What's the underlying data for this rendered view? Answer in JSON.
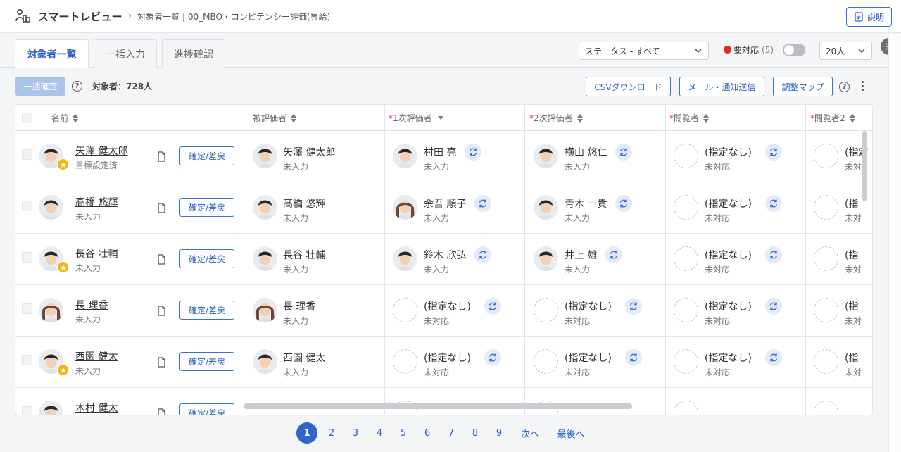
{
  "app": {
    "title": "スマートレビュー",
    "breadcrumb": "対象者一覧 | 00_MBO・コンピテンシー評価(昇給)",
    "help_label": "説明"
  },
  "tabs": [
    {
      "label": "対象者一覧",
      "active": true
    },
    {
      "label": "一括入力",
      "active": false
    },
    {
      "label": "進捗確認",
      "active": false
    }
  ],
  "filters": {
    "status": "ステータス - すべて",
    "urgent_label": "要対応",
    "urgent_count": "(5)",
    "urgent_toggle_on": false,
    "per_page": "20人"
  },
  "toolbar": {
    "bulk_confirm": "一括確定",
    "target_count": "対象者：728人",
    "csv": "CSVダウンロード",
    "mail": "メール・通知送信",
    "map": "調整マップ"
  },
  "columns": {
    "name": "名前",
    "evaluatee": "被評価者",
    "eval1": "1次評価者",
    "eval2": "2次評価者",
    "viewer": "閲覧者",
    "viewer2": "閲覧者2",
    "required_mark": "*"
  },
  "rows": [
    {
      "name": "矢澤 健太郎",
      "status": "目標設定済",
      "star": true,
      "confirm": "確定/差戻",
      "evaluatee": {
        "name": "矢澤 健太郎",
        "status": "未入力"
      },
      "eval1": {
        "name": "村田 亮",
        "status": "未入力",
        "avatar": true
      },
      "eval2": {
        "name": "横山 悠仁",
        "status": "未入力",
        "avatar": true
      },
      "viewer": {
        "name": "(指定なし)",
        "status": "未対応"
      },
      "viewer2": {
        "name": "(指定",
        "status": "未対"
      }
    },
    {
      "name": "髙橋 悠輝",
      "status": "未入力",
      "star": false,
      "confirm": "確定/差戻",
      "evaluatee": {
        "name": "髙橋 悠輝",
        "status": "未入力"
      },
      "eval1": {
        "name": "余吾 順子",
        "status": "未入力",
        "avatar": true
      },
      "eval2": {
        "name": "青木 一貴",
        "status": "未入力",
        "avatar": true
      },
      "viewer": {
        "name": "(指定なし)",
        "status": "未対応"
      },
      "viewer2": {
        "name": "(指",
        "status": "未対"
      }
    },
    {
      "name": "長谷 壮輔",
      "status": "未入力",
      "star": true,
      "confirm": "確定/差戻",
      "evaluatee": {
        "name": "長谷 壮輔",
        "status": "未入力"
      },
      "eval1": {
        "name": "鈴木 欣弘",
        "status": "未入力",
        "avatar": true
      },
      "eval2": {
        "name": "井上 雄",
        "status": "未入力",
        "avatar": true
      },
      "viewer": {
        "name": "(指定なし)",
        "status": "未対応"
      },
      "viewer2": {
        "name": "(指",
        "status": "未対"
      }
    },
    {
      "name": "長 理香",
      "status": "未入力",
      "star": false,
      "confirm": "確定/差戻",
      "evaluatee": {
        "name": "長 理香",
        "status": "未入力"
      },
      "eval1": {
        "name": "(指定なし)",
        "status": "未対応",
        "avatar": false
      },
      "eval2": {
        "name": "(指定なし)",
        "status": "未対応",
        "avatar": false
      },
      "viewer": {
        "name": "(指定なし)",
        "status": "未対応"
      },
      "viewer2": {
        "name": "(指",
        "status": "未対"
      }
    },
    {
      "name": "西園 健太",
      "status": "未入力",
      "star": true,
      "confirm": "確定/差戻",
      "evaluatee": {
        "name": "西園 健太",
        "status": "未入力"
      },
      "eval1": {
        "name": "(指定なし)",
        "status": "未対応",
        "avatar": false
      },
      "eval2": {
        "name": "(指定なし)",
        "status": "未対応",
        "avatar": false
      },
      "viewer": {
        "name": "(指定なし)",
        "status": "未対応"
      },
      "viewer2": {
        "name": "(指",
        "status": "未対"
      }
    },
    {
      "name": "木村 健太",
      "status": "",
      "star": false,
      "confirm": "確定/差戻",
      "evaluatee": {
        "name": "",
        "status": ""
      },
      "eval1": {
        "name": "",
        "status": "",
        "avatar": false
      },
      "eval2": {
        "name": "",
        "status": "",
        "avatar": false
      },
      "viewer": {
        "name": "",
        "status": ""
      },
      "viewer2": {
        "name": "",
        "status": ""
      }
    }
  ],
  "pagination": {
    "current": "1",
    "pages": [
      "2",
      "3",
      "4",
      "5",
      "6",
      "7",
      "8",
      "9"
    ],
    "next": "次へ",
    "last": "最後へ"
  }
}
